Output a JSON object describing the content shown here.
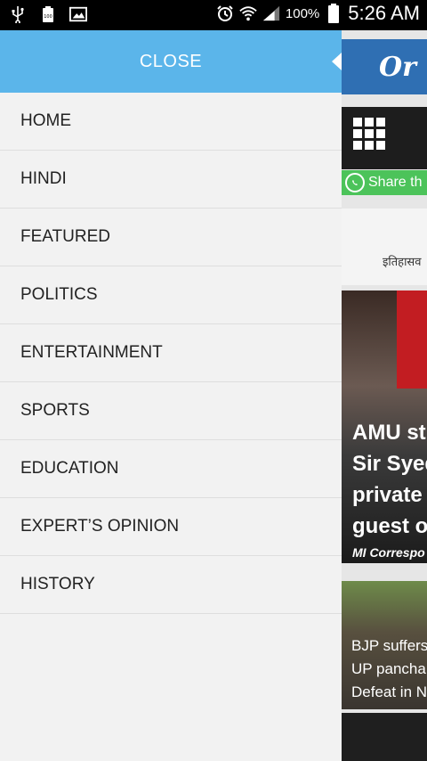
{
  "status_bar": {
    "left_icons": [
      "usb-icon",
      "battery-saver-icon",
      "gallery-icon"
    ],
    "right_icons": [
      "alarm-icon",
      "wifi-icon",
      "signal-icon",
      "battery-icon"
    ],
    "battery_percent": "100%",
    "time": "5:26 AM"
  },
  "drawer": {
    "close_label": "CLOSE",
    "accent_color": "#5bb5ea",
    "menu_items": [
      {
        "label": "HOME"
      },
      {
        "label": "HINDI"
      },
      {
        "label": "FEATURED"
      },
      {
        "label": "POLITICS"
      },
      {
        "label": "ENTERTAINMENT"
      },
      {
        "label": "SPORTS"
      },
      {
        "label": "EDUCATION"
      },
      {
        "label": "EXPERT’S OPINION"
      },
      {
        "label": "HISTORY"
      }
    ]
  },
  "content_peek": {
    "logo_text": "Or",
    "share_label": "Share th",
    "ticker_text": "इतिहासव",
    "story1": {
      "headline_lines": [
        "AMU st",
        "Sir Syed",
        "private",
        "guest o"
      ],
      "byline": "MI Correspo"
    },
    "story2": {
      "headline_lines": [
        "BJP suffers",
        "UP pancha",
        "Defeat in N"
      ]
    }
  }
}
